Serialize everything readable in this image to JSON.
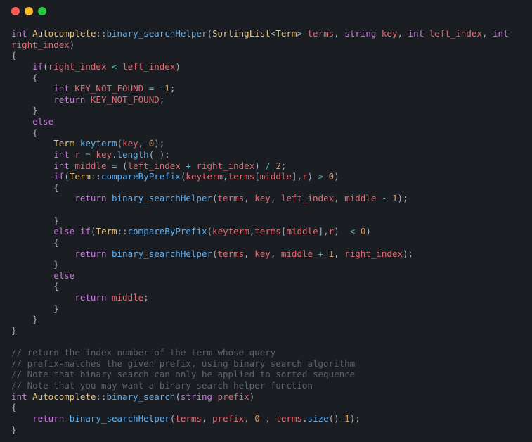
{
  "code": {
    "l1": {
      "kw1": "int",
      "type1": "Autocomplete",
      "op1": "::",
      "fn1": "binary_searchHelper",
      "p1": "(",
      "type2": "SortingList",
      "op2": "<",
      "type3": "Term",
      "op3": ">",
      "sp": " ",
      "var1": "terms",
      "c1": ", ",
      "kw2": "string",
      "sp2": " ",
      "var2": "key",
      "c2": ", ",
      "kw3": "int",
      "sp3": " ",
      "var3": "left_index",
      "c3": ", ",
      "kw4": "int"
    },
    "l2": {
      "var1": "right_index",
      "p2": ")"
    },
    "l3": {
      "p": "{"
    },
    "l4": {
      "kw": "if",
      "p1": "(",
      "var1": "right_index",
      "op": " < ",
      "var2": "left_index",
      "p2": ")"
    },
    "l5": {
      "p": "{"
    },
    "l6": {
      "kw": "int",
      "sp": " ",
      "var": "KEY_NOT_FOUND",
      "op": " = ",
      "neg": "-",
      "num": "1",
      "p": ";"
    },
    "l7": {
      "kw": "return",
      "sp": " ",
      "var": "KEY_NOT_FOUND",
      "p": ";"
    },
    "l8": {
      "p": "}"
    },
    "l9": {
      "kw": "else"
    },
    "l10": {
      "p": "{"
    },
    "l11": {
      "type": "Term",
      "sp": " ",
      "fn": "keyterm",
      "p1": "(",
      "var": "key",
      "c": ", ",
      "num": "0",
      "p2": ");"
    },
    "l12": {
      "kw": "int",
      "sp": " ",
      "var": "r",
      "op": " = ",
      "var2": "key",
      "p1": ".",
      "fn": "length",
      "p2": "( );"
    },
    "l13": {
      "kw": "int",
      "sp": " ",
      "var": "middle",
      "op": " = ",
      "p1": "(",
      "var2": "left_index",
      "op2": " + ",
      "var3": "right_index",
      "p2": ") ",
      "op3": "/ ",
      "num": "2",
      "p3": ";"
    },
    "l14": {
      "kw": "if",
      "p1": "(",
      "type": "Term",
      "op1": "::",
      "fn": "compareByPrefix",
      "p2": "(",
      "var1": "keyterm",
      "c1": ",",
      "var2": "terms",
      "p3": "[",
      "var3": "middle",
      "p4": "],",
      "var4": "r",
      "p5": ") ",
      "op2": "> ",
      "num": "0",
      "p6": ")"
    },
    "l15": {
      "p": "{"
    },
    "l16": {
      "kw": "return",
      "sp": " ",
      "fn": "binary_searchHelper",
      "p1": "(",
      "var1": "terms",
      "c1": ", ",
      "var2": "key",
      "c2": ", ",
      "var3": "left_index",
      "c3": ", ",
      "var4": "middle",
      "op": " - ",
      "num": "1",
      "p2": ");"
    },
    "l17": "",
    "l18": {
      "p": "}"
    },
    "l19": {
      "kw1": "else",
      "sp": " ",
      "kw2": "if",
      "p1": "(",
      "type": "Term",
      "op1": "::",
      "fn": "compareByPrefix",
      "p2": "(",
      "var1": "keyterm",
      "c1": ",",
      "var2": "terms",
      "p3": "[",
      "var3": "middle",
      "p4": "],",
      "var4": "r",
      "p5": ")  ",
      "op2": "< ",
      "num": "0",
      "p6": ")"
    },
    "l20": {
      "p": "{"
    },
    "l21": {
      "kw": "return",
      "sp": " ",
      "fn": "binary_searchHelper",
      "p1": "(",
      "var1": "terms",
      "c1": ", ",
      "var2": "key",
      "c2": ", ",
      "var3": "middle",
      "op": " + ",
      "num": "1",
      "c3": ", ",
      "var4": "right_index",
      "p2": ");"
    },
    "l22": {
      "p": "}"
    },
    "l23": {
      "kw": "else"
    },
    "l24": {
      "p": "{"
    },
    "l25": {
      "kw": "return",
      "sp": " ",
      "var": "middle",
      "p": ";"
    },
    "l26": {
      "p": "}"
    },
    "l27": {
      "p": "}"
    },
    "l28": {
      "p": "}"
    },
    "l29": "",
    "l30": {
      "cmt": "// return the index number of the term whose query"
    },
    "l31": {
      "cmt": "// prefix-matches the given prefix, using binary search algorithm"
    },
    "l32": {
      "cmt": "// Note that binary search can only be applied to sorted sequence"
    },
    "l33": {
      "cmt": "// Note that you may want a binary search helper function"
    },
    "l34": {
      "kw1": "int",
      "sp": " ",
      "type": "Autocomplete",
      "op1": "::",
      "fn": "binary_search",
      "p1": "(",
      "kw2": "string",
      "sp2": " ",
      "var": "prefix",
      "p2": ")"
    },
    "l35": {
      "p": "{"
    },
    "l36": {
      "kw": "return",
      "sp": " ",
      "fn": "binary_searchHelper",
      "p1": "(",
      "var1": "terms",
      "c1": ", ",
      "var2": "prefix",
      "c2": ", ",
      "num1": "0",
      "sp2": " ",
      "c3": ", ",
      "var3": "terms",
      "p2": ".",
      "fn2": "size",
      "p3": "()",
      "op": "-",
      "num2": "1",
      "p4": ");"
    },
    "l37": {
      "p": "}"
    }
  }
}
